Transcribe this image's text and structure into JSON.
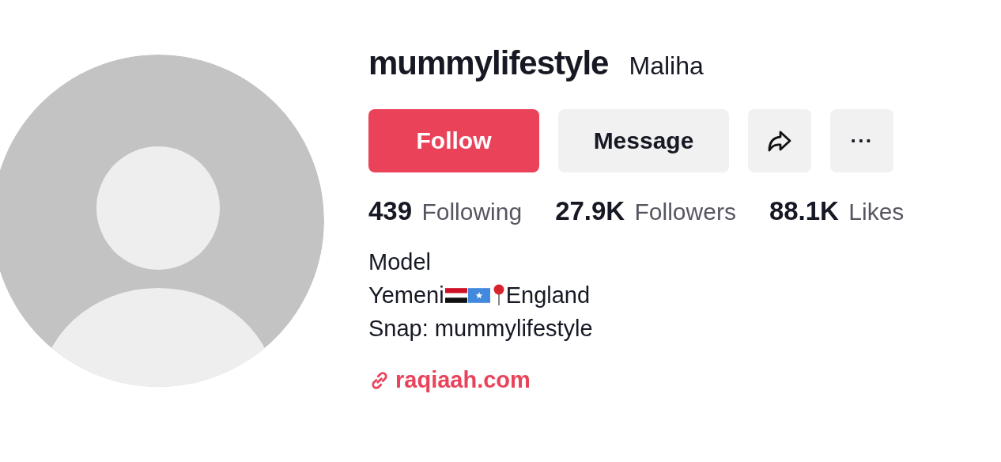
{
  "profile": {
    "username": "mummylifestyle",
    "display_name": "Maliha"
  },
  "buttons": [
    {
      "kind": "follow",
      "label": "Follow"
    },
    {
      "kind": "message",
      "label": "Message"
    },
    {
      "kind": "share"
    },
    {
      "kind": "more",
      "label": "···"
    }
  ],
  "stats": [
    "**439** Following",
    "**27.9K** Followers",
    "**88.1K** Likes"
  ],
  "bio": [
    {
      "parts": [
        {
          "kind": "text",
          "text": "Model"
        }
      ]
    },
    {
      "parts": [
        {
          "kind": "text",
          "text": "Yemeni"
        },
        {
          "kind": "flag-yemen"
        },
        {
          "kind": "flag-somalia"
        },
        {
          "kind": "pin"
        },
        {
          "kind": "text",
          "text": "England"
        }
      ]
    },
    {
      "parts": [
        {
          "kind": "text",
          "text": "Snap: mummylifestyle"
        }
      ]
    }
  ],
  "link": "raqiaah.com"
}
